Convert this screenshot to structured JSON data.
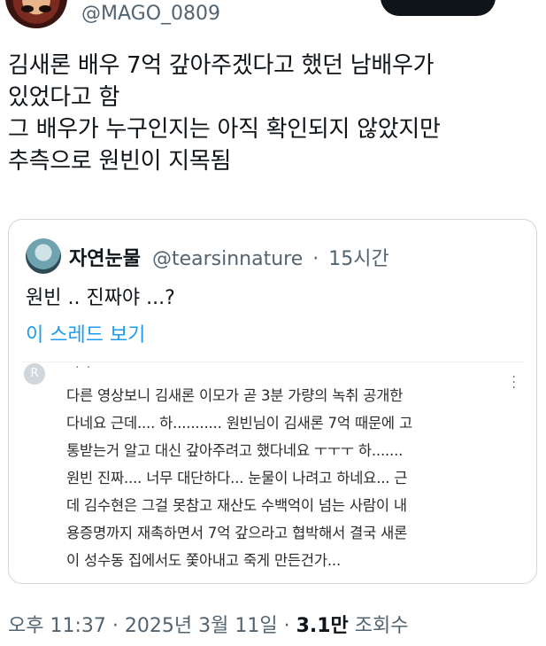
{
  "author": {
    "handle": "@MAGO_0809"
  },
  "tweet": {
    "text": "김새론 배우 7억 갚아주겠다고 했던 남배우가\n있었다고 함\n그 배우가 누구인지는 아직 확인되지 않았지만\n추측으로 원빈이 지목됨"
  },
  "quote": {
    "name": "자연눈물",
    "handle": "@tearsinnature",
    "separator": "·",
    "time": "15시간",
    "text": "원빈 .. 진짜야 ...?",
    "thread_link": "이 스레드 보기",
    "image": {
      "avatar_letter": "R",
      "comment": "다른 영상보니 김새론 이모가 곧 3분 가량의 녹취 공개한\n다네요 근데.... 하........... 원빈님이 김새론 7억 때문에 고\n통받는거 알고 대신 갚아주려고 했다네요 ㅜㅜㅜ 하.......\n원빈 진짜.... 너무 대단하다... 눈물이 나려고 하네요... 근\n데 김수현은 그걸 못참고 재산도 수백억이 넘는 사람이 내\n용증명까지 재촉하면서 7억 갚으라고 협박해서 결국 새론\n이 성수동 집에서도 쫓아내고 죽게 만든건가..."
    }
  },
  "meta": {
    "time": "오후 11:37",
    "sep1": "·",
    "date": "2025년 3월 11일",
    "sep2": "·",
    "views_count": "3.1만",
    "views_label": "조회수"
  }
}
